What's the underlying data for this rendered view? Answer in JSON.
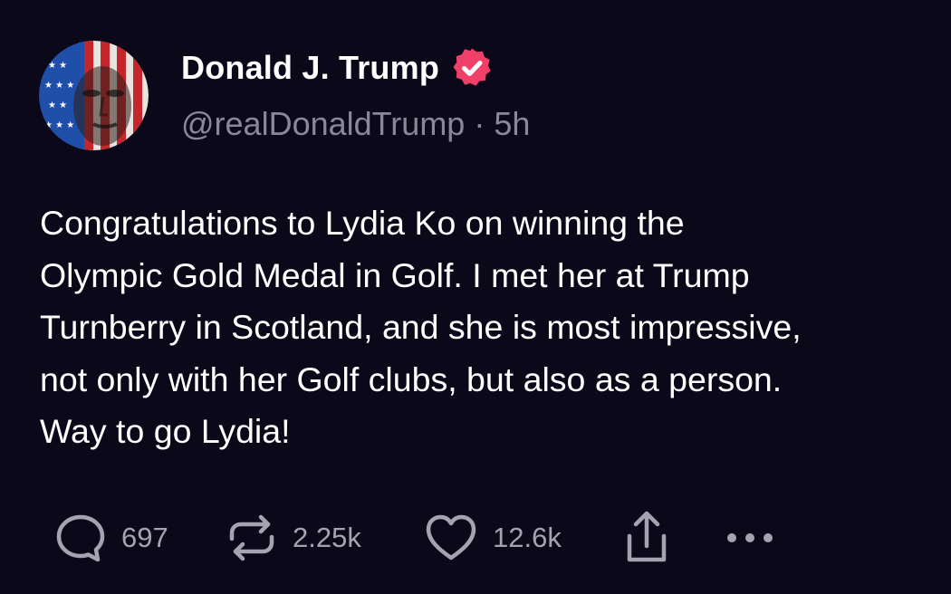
{
  "post": {
    "author": {
      "display_name": "Donald J. Trump",
      "handle": "@realDonaldTrump",
      "verified": true,
      "avatar_icon": "flag-portrait-avatar"
    },
    "separator": "·",
    "time_ago": "5h",
    "text_lines": [
      "Congratulations to Lydia Ko on winning the",
      "Olympic Gold Medal in Golf. I met her at Trump",
      "Turnberry in Scotland, and she is most impressive,",
      "not only with her Golf clubs, but also as a person.",
      "Way to go Lydia!"
    ],
    "actions": {
      "replies": "697",
      "reposts": "2.25k",
      "likes": "12.6k"
    }
  },
  "colors": {
    "background": "#0b0819",
    "verified_badge": "#f0406a",
    "muted_text": "#8c8798",
    "action_icon": "#a7a2b2"
  }
}
